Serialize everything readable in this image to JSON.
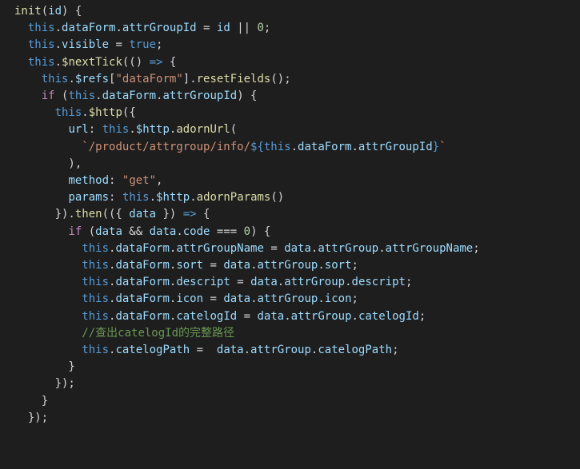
{
  "code": {
    "fnName": "init",
    "param": "id",
    "assigns": {
      "attrGroupId": "attrGroupId",
      "fallback": "0",
      "visibleProp": "visible",
      "visibleVal": "true"
    },
    "nextTick": "$nextTick",
    "refs": "$refs",
    "dataFormKey": "\"dataForm\"",
    "resetFields": "resetFields",
    "dataForm": "dataForm",
    "http": "$http",
    "urlKey": "url",
    "adornUrl": "adornUrl",
    "templatePrefix": "`/product/attrgroup/info/",
    "interp": "${",
    "interpEnd": "}",
    "templateSuffix": "`",
    "methodKey": "method",
    "methodVal": "\"get\"",
    "paramsKey": "params",
    "adornParams": "adornParams",
    "then": "then",
    "destructData": "data",
    "codeProp": "code",
    "zero": "0",
    "attrGroup": "attrGroup",
    "attrGroupName": "attrGroupName",
    "sort": "sort",
    "descript": "descript",
    "icon": "icon",
    "catelogId": "catelogId",
    "comment": "//查出catelogId的完整路径",
    "catelogPath": "catelogPath"
  }
}
